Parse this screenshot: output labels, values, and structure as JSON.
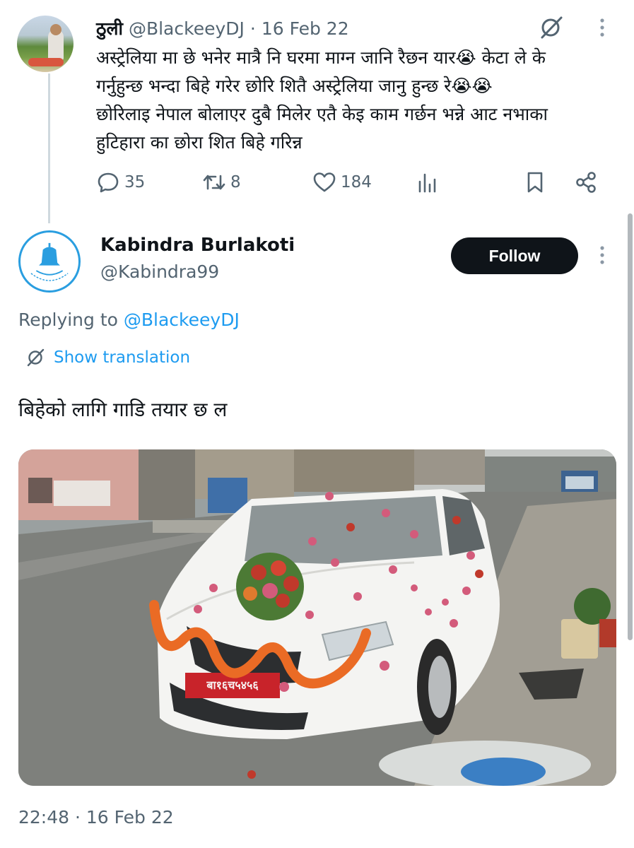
{
  "first_tweet": {
    "display_name": "ठुली",
    "handle": "@BlackeeyDJ",
    "separator": "·",
    "date": "16 Feb 22",
    "lines": [
      "अस्ट्रेलिया मा छे भनेर मात्रै नि  घरमा माग्न जानि रैछन यार😭  केटा ले के",
      "गर्नुहुन्छ भन्दा बिहे गरेर छोरि शितै अस्ट्रेलिया जानु हुन्छ रे😭😭",
      "छोरिलाइ नेपाल बोलाएर दुबै मिलेर एतै केइ काम गर्छन भन्ने आट नभाका",
      "हुटिहारा का छोरा शित बिहे गरिन्न"
    ],
    "icons": {
      "grok": "grok-icon",
      "more": "more-vertical-icon"
    },
    "actions": {
      "reply_count": "35",
      "retweet_count": "8",
      "like_count": "184"
    }
  },
  "second_tweet": {
    "display_name": "Kabindra Burlakoti",
    "handle": "@Kabindra99",
    "follow_label": "Follow",
    "replying_prefix": "Replying to ",
    "replying_to": "@BlackeeyDJ",
    "translate_label": "Show translation",
    "text": "बिहेको लागि गाडि तयार छ ल",
    "plate": "बा१६च५४५६",
    "timestamp": "22:48 · 16 Feb 22"
  },
  "colors": {
    "text": "#0f1419",
    "secondary": "#536471",
    "link": "#1d9bf0",
    "follow_bg": "#0f1419",
    "thread_line": "#cfd9de"
  }
}
